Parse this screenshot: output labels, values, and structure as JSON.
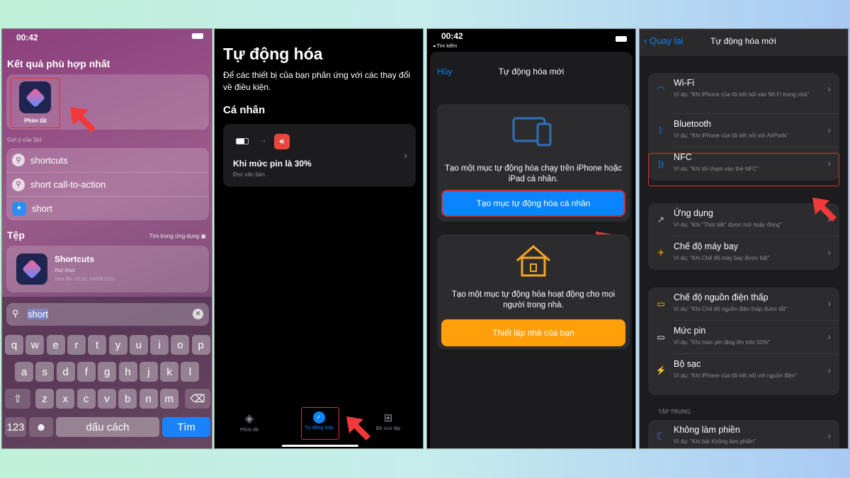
{
  "panel1": {
    "time": "00:42",
    "best_match_title": "Kết quả phù hợp nhất",
    "best_match_app": "Phím tắt",
    "siri_label": "Gợi ý của Siri",
    "suggestions": [
      {
        "label": "shortcuts",
        "icon": "search-icon"
      },
      {
        "label": "short call-to-action",
        "icon": "search-icon"
      },
      {
        "label": "short",
        "icon": "safari-icon"
      }
    ],
    "files_title": "Tệp",
    "search_in_app": "Tìm trong ứng dụng",
    "file": {
      "name": "Shortcuts",
      "type": "thư mục",
      "modified": "Sửa đổi: 22:31, 04/09/2022"
    },
    "search_value": "short",
    "keyboard": {
      "row1": [
        "q",
        "w",
        "e",
        "r",
        "t",
        "y",
        "u",
        "i",
        "o",
        "p"
      ],
      "row2": [
        "a",
        "s",
        "d",
        "f",
        "g",
        "h",
        "j",
        "k",
        "l"
      ],
      "row3": [
        "z",
        "x",
        "c",
        "v",
        "b",
        "n",
        "m"
      ],
      "shift": "⇧",
      "delete": "⌫",
      "numbers": "123",
      "emoji": "☻",
      "space": "dấu cách",
      "go": "Tìm"
    }
  },
  "panel2": {
    "title": "Tự động hóa",
    "description": "Để các thiết bị của bạn phản ứng với các thay đổi về điều kiện.",
    "section": "Cá nhân",
    "automation": {
      "title": "Khi mức pin là 30%",
      "action": "Đọc văn bản"
    },
    "tabs": [
      {
        "label": "Phím tắt",
        "active": false
      },
      {
        "label": "Tự động hóa",
        "active": true
      },
      {
        "label": "Bộ sưu tập",
        "active": false
      }
    ]
  },
  "panel3": {
    "time": "00:42",
    "back_app": "◂ Tìm kiếm",
    "cancel": "Hủy",
    "title": "Tự động hóa mới",
    "personal_text": "Tạo một mục tự động hóa chạy trên iPhone hoặc iPad cá nhân.",
    "personal_button": "Tạo mục tự động hóa cá nhân",
    "home_text": "Tạo một mục tự động hóa hoạt động cho mọi người trong nhà.",
    "home_button": "Thiết lập nhà của bạn"
  },
  "panel4": {
    "back": "Quay lại",
    "title": "Tự động hóa mới",
    "groups": [
      [
        {
          "title": "Wi-Fi",
          "subtitle": "Ví dụ: \"Khi iPhone của tôi kết nối vào Wi-Fi trong nhà\"",
          "icon": "wifi-icon"
        },
        {
          "title": "Bluetooth",
          "subtitle": "Ví dụ: \"Khi iPhone của tôi kết nối với AirPods\"",
          "icon": "bluetooth-icon"
        },
        {
          "title": "NFC",
          "subtitle": "Ví dụ: \"Khi tôi chạm vào thẻ NFC\"",
          "icon": "nfc-icon"
        }
      ],
      [
        {
          "title": "Ứng dụng",
          "subtitle": "Ví dụ: \"Khi \"Thời tiết\" được mở hoặc đóng\"",
          "icon": "app-icon"
        },
        {
          "title": "Chế độ máy bay",
          "subtitle": "Ví dụ: \"Khi Chế độ máy bay được bật\"",
          "icon": "airplane-icon"
        }
      ],
      [
        {
          "title": "Chế độ nguồn điện thấp",
          "subtitle": "Ví dụ: \"Khi Chế độ nguồn điện thấp được tắt\"",
          "icon": "low-power-icon"
        },
        {
          "title": "Mức pin",
          "subtitle": "Ví dụ: \"Khi mức pin tăng lên trên 50%\"",
          "icon": "battery-icon"
        },
        {
          "title": "Bộ sạc",
          "subtitle": "Ví dụ: \"Khi iPhone của tôi kết nối với nguồn điện\"",
          "icon": "charger-icon"
        }
      ]
    ],
    "focus_label": "TẬP TRUNG",
    "focus": {
      "title": "Không làm phiền",
      "subtitle": "Ví dụ: \"Khi bật Không làm phiền\"",
      "icon": "moon-icon"
    }
  },
  "colors": {
    "ios_blue": "#0a84ff",
    "orange": "#ff9f0a",
    "highlight_red": "#e03030"
  }
}
